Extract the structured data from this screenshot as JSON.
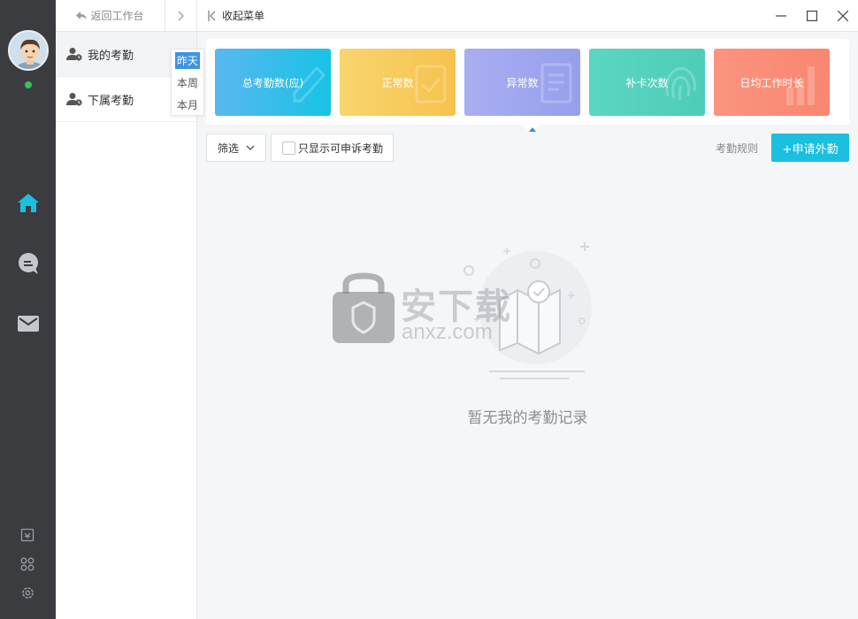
{
  "subnav": {
    "back_label": "返回工作台",
    "items": [
      {
        "label": "我的考勤"
      },
      {
        "label": "下属考勤"
      }
    ]
  },
  "period_options": [
    "昨天",
    "本周",
    "本月"
  ],
  "period_selected": "昨天",
  "titlebar": {
    "collapse_label": "收起菜单"
  },
  "cards": [
    {
      "label": "总考勤数(应)",
      "color": "#3db6ee"
    },
    {
      "label": "正常数",
      "color": "#f6cb5c"
    },
    {
      "label": "异常数",
      "color": "#a0a7ee"
    },
    {
      "label": "补卡次数",
      "color": "#56d2be"
    },
    {
      "label": "日均工作时长",
      "color": "#f98a76"
    }
  ],
  "toolbar": {
    "filter_label": "筛选",
    "only_appealable_label": "只显示可申诉考勤",
    "rules_label": "考勤规则",
    "apply_label": "+申请外勤"
  },
  "empty": {
    "message": "暂无我的考勤记录"
  },
  "watermark": {
    "cn": "安下载",
    "url": "anxz.com",
    "badge": "安"
  },
  "colors": {
    "rail": "#3b3c40",
    "accent": "#1bbfe0",
    "online": "#35c25a"
  }
}
